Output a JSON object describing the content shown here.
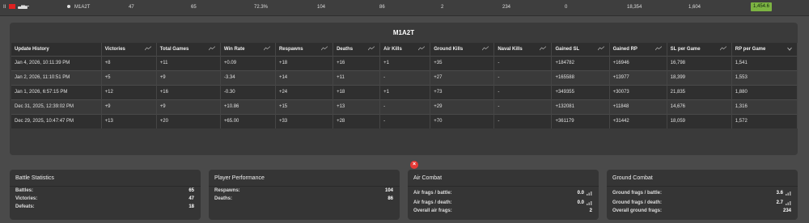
{
  "top_row": {
    "rank": "II",
    "vehicle_name": "M1A2T",
    "stats": [
      "47",
      "65",
      "72.3%",
      "104",
      "86",
      "2",
      "234",
      "0",
      "18,354",
      "1,604"
    ],
    "score": "1,454.6",
    "score_color": "#7cb342"
  },
  "panel": {
    "title": "M1A2T",
    "headers": [
      "Update History",
      "Victories",
      "Total Games",
      "Win Rate",
      "Respawns",
      "Deaths",
      "Air Kills",
      "Ground Kills",
      "Naval Kills",
      "Gained SL",
      "Gained RP",
      "SL per Game",
      "RP per Game"
    ],
    "rows": [
      [
        "Jan 4, 2026, 10:11:39 PM",
        "+8",
        "+11",
        "+0.09",
        "+18",
        "+16",
        "+1",
        "+35",
        "-",
        "+184782",
        "+16946",
        "16,798",
        "1,541"
      ],
      [
        "Jan 2, 2026, 11:10:51 PM",
        "+5",
        "+9",
        "-3.34",
        "+14",
        "+11",
        "-",
        "+27",
        "-",
        "+165588",
        "+13977",
        "18,399",
        "1,553"
      ],
      [
        "Jan 1, 2026, 6:57:15 PM",
        "+12",
        "+16",
        "-0.30",
        "+24",
        "+18",
        "+1",
        "+73",
        "-",
        "+349355",
        "+30073",
        "21,835",
        "1,880"
      ],
      [
        "Dec 31, 2025, 12:39:02 PM",
        "+9",
        "+9",
        "+10.86",
        "+15",
        "+13",
        "-",
        "+29",
        "-",
        "+132081",
        "+11848",
        "14,676",
        "1,316"
      ],
      [
        "Dec 29, 2025, 10:47:47 PM",
        "+13",
        "+20",
        "+65.00",
        "+33",
        "+28",
        "-",
        "+70",
        "-",
        "+361179",
        "+31442",
        "18,059",
        "1,572"
      ]
    ],
    "close_symbol": "×"
  },
  "cards": {
    "battle": {
      "title": "Battle Statistics",
      "rows": [
        {
          "k": "Battles:",
          "v": "65"
        },
        {
          "k": "Victories:",
          "v": "47"
        },
        {
          "k": "Defeats:",
          "v": "18"
        }
      ]
    },
    "player": {
      "title": "Player Performance",
      "rows": [
        {
          "k": "Respawns:",
          "v": "104"
        },
        {
          "k": "Deaths:",
          "v": "86"
        }
      ]
    },
    "air": {
      "title": "Air Combat",
      "rows": [
        {
          "k": "Air frags / battle:",
          "v": "0.0"
        },
        {
          "k": "Air frags / death:",
          "v": "0.0"
        },
        {
          "k": "Overall air frags:",
          "v": "2"
        }
      ]
    },
    "ground": {
      "title": "Ground Combat",
      "rows": [
        {
          "k": "Ground frags / battle:",
          "v": "3.6"
        },
        {
          "k": "Ground frags / death:",
          "v": "2.7"
        },
        {
          "k": "Overall ground frags:",
          "v": "234"
        }
      ]
    }
  }
}
